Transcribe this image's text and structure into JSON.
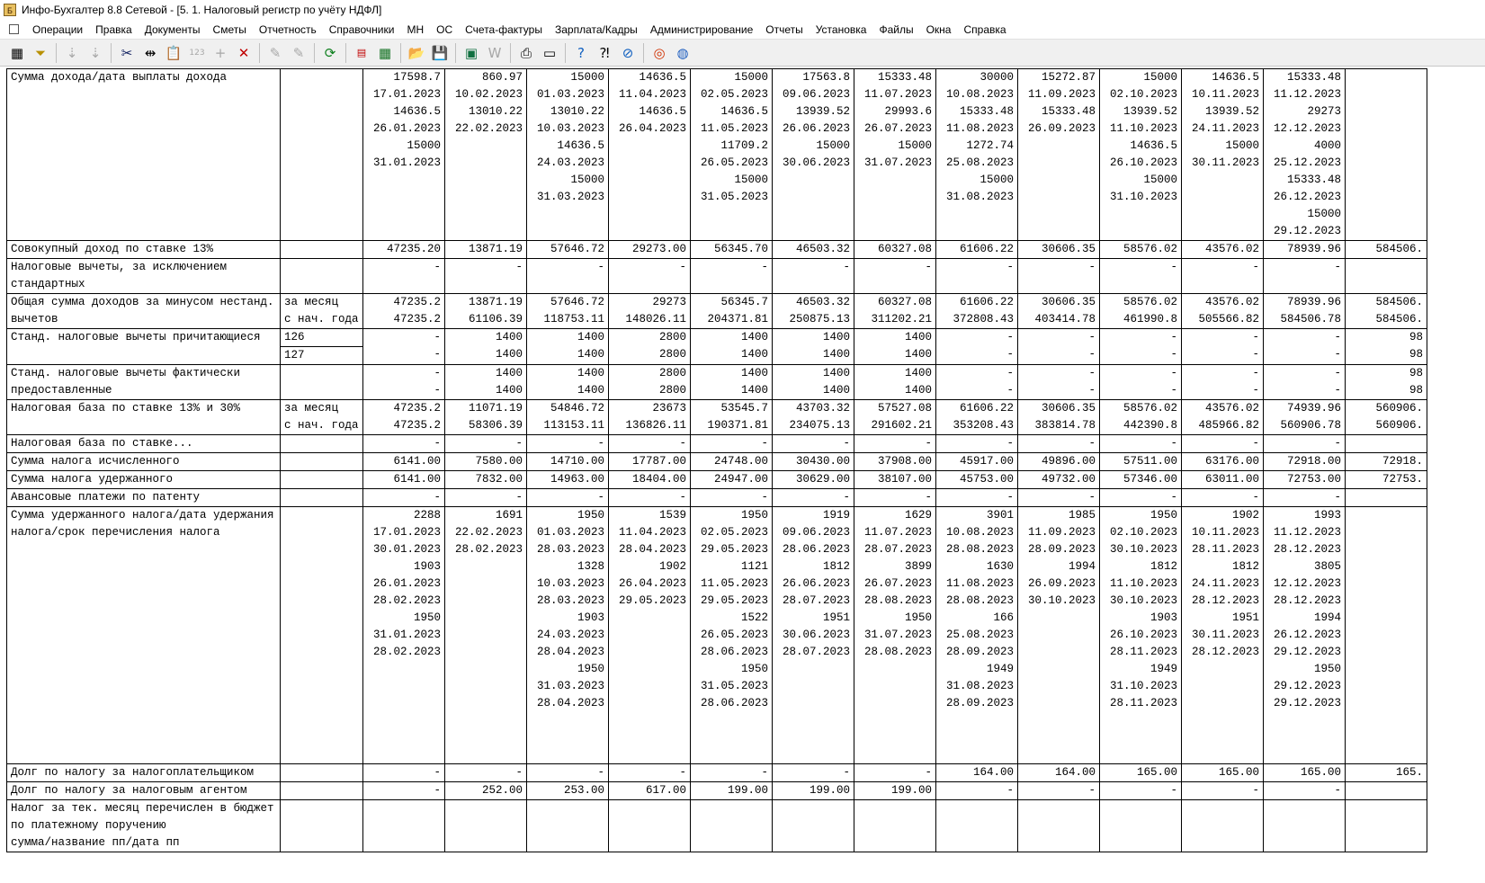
{
  "window": {
    "title": "Инфо-Бухгалтер 8.8 Сетевой - [5. 1. Налоговый регистр по учёту НДФЛ]"
  },
  "menu": [
    "Операции",
    "Правка",
    "Документы",
    "Сметы",
    "Отчетность",
    "Справочники",
    "МН",
    "ОС",
    "Счета-фактуры",
    "Зарплата/Кадры",
    "Администрирование",
    "Отчеты",
    "Установка",
    "Файлы",
    "Окна",
    "Справка"
  ],
  "toolbar_icons": [
    "table-icon",
    "filter-icon",
    "sort-asc-icon",
    "sort-desc-icon",
    "cut-icon",
    "columns-icon",
    "paste-icon",
    "numbering-icon",
    "add-icon",
    "delete-icon",
    "brush-icon",
    "brush-clear-icon",
    "refresh-icon",
    "pdf-icon",
    "calculator-icon",
    "open-folder-icon",
    "save-icon",
    "excel-icon",
    "word-icon",
    "print-icon",
    "preview-icon",
    "help-icon",
    "context-help-icon",
    "navigator-icon",
    "support-icon",
    "web-icon"
  ],
  "register": {
    "rows": [
      {
        "label": [
          "Сумма дохода/дата выплаты дохода"
        ],
        "sub": [
          ""
        ],
        "lines": 10,
        "cells": [
          [
            "17598.7",
            "17.01.2023",
            "14636.5",
            "26.01.2023",
            "15000",
            "31.01.2023"
          ],
          [
            "860.97",
            "10.02.2023",
            "13010.22",
            "22.02.2023"
          ],
          [
            "15000",
            "01.03.2023",
            "13010.22",
            "10.03.2023",
            "14636.5",
            "24.03.2023",
            "15000",
            "31.03.2023"
          ],
          [
            "14636.5",
            "11.04.2023",
            "14636.5",
            "26.04.2023"
          ],
          [
            "15000",
            "02.05.2023",
            "14636.5",
            "11.05.2023",
            "11709.2",
            "26.05.2023",
            "15000",
            "31.05.2023"
          ],
          [
            "17563.8",
            "09.06.2023",
            "13939.52",
            "26.06.2023",
            "15000",
            "30.06.2023"
          ],
          [
            "15333.48",
            "11.07.2023",
            "29993.6",
            "26.07.2023",
            "15000",
            "31.07.2023"
          ],
          [
            "30000",
            "10.08.2023",
            "15333.48",
            "11.08.2023",
            "1272.74",
            "25.08.2023",
            "15000",
            "31.08.2023"
          ],
          [
            "15272.87",
            "11.09.2023",
            "15333.48",
            "26.09.2023"
          ],
          [
            "15000",
            "02.10.2023",
            "13939.52",
            "11.10.2023",
            "14636.5",
            "26.10.2023",
            "15000",
            "31.10.2023"
          ],
          [
            "14636.5",
            "10.11.2023",
            "13939.52",
            "24.11.2023",
            "15000",
            "30.11.2023"
          ],
          [
            "15333.48",
            "11.12.2023",
            "29273",
            "12.12.2023",
            "4000",
            "25.12.2023",
            "15333.48",
            "26.12.2023",
            "15000",
            "29.12.2023"
          ],
          [
            ""
          ]
        ]
      },
      {
        "label": [
          "Совокупный доход по ставке 13%"
        ],
        "sub": [
          ""
        ],
        "lines": 1,
        "cells": [
          [
            "47235.20"
          ],
          [
            "13871.19"
          ],
          [
            "57646.72"
          ],
          [
            "29273.00"
          ],
          [
            "56345.70"
          ],
          [
            "46503.32"
          ],
          [
            "60327.08"
          ],
          [
            "61606.22"
          ],
          [
            "30606.35"
          ],
          [
            "58576.02"
          ],
          [
            "43576.02"
          ],
          [
            "78939.96"
          ],
          [
            "584506."
          ]
        ]
      },
      {
        "label": [
          "Налоговые вычеты, за исключением",
          "стандартных"
        ],
        "sub": [
          ""
        ],
        "lines": 2,
        "cells": [
          [
            "-"
          ],
          [
            "-"
          ],
          [
            "-"
          ],
          [
            "-"
          ],
          [
            "-"
          ],
          [
            "-"
          ],
          [
            "-"
          ],
          [
            "-"
          ],
          [
            "-"
          ],
          [
            "-"
          ],
          [
            "-"
          ],
          [
            "-"
          ],
          [
            ""
          ]
        ]
      },
      {
        "label": [
          "Общая сумма доходов за минусом нестанд.",
          "вычетов"
        ],
        "sub": [
          "за месяц",
          "с нач. года"
        ],
        "lines": 2,
        "cells": [
          [
            "47235.2",
            "47235.2"
          ],
          [
            "13871.19",
            "61106.39"
          ],
          [
            "57646.72",
            "118753.11"
          ],
          [
            "29273",
            "148026.11"
          ],
          [
            "56345.7",
            "204371.81"
          ],
          [
            "46503.32",
            "250875.13"
          ],
          [
            "60327.08",
            "311202.21"
          ],
          [
            "61606.22",
            "372808.43"
          ],
          [
            "30606.35",
            "403414.78"
          ],
          [
            "58576.02",
            "461990.8"
          ],
          [
            "43576.02",
            "505566.82"
          ],
          [
            "78939.96",
            "584506.78"
          ],
          [
            "584506.",
            "584506."
          ]
        ]
      },
      {
        "label": [
          "Станд. налоговые вычеты причитающиеся"
        ],
        "sub": [
          "126",
          "127"
        ],
        "lines": 2,
        "split_sub": true,
        "cells": [
          [
            "-",
            "-"
          ],
          [
            "1400",
            "1400"
          ],
          [
            "1400",
            "1400"
          ],
          [
            "2800",
            "2800"
          ],
          [
            "1400",
            "1400"
          ],
          [
            "1400",
            "1400"
          ],
          [
            "1400",
            "1400"
          ],
          [
            "-",
            "-"
          ],
          [
            "-",
            "-"
          ],
          [
            "-",
            "-"
          ],
          [
            "-",
            "-"
          ],
          [
            "-",
            "-"
          ],
          [
            "98",
            "98"
          ]
        ]
      },
      {
        "label": [
          "Станд. налоговые вычеты фактически",
          "предоставленные"
        ],
        "sub": [
          ""
        ],
        "lines": 2,
        "cells": [
          [
            "-",
            "-"
          ],
          [
            "1400",
            "1400"
          ],
          [
            "1400",
            "1400"
          ],
          [
            "2800",
            "2800"
          ],
          [
            "1400",
            "1400"
          ],
          [
            "1400",
            "1400"
          ],
          [
            "1400",
            "1400"
          ],
          [
            "-",
            "-"
          ],
          [
            "-",
            "-"
          ],
          [
            "-",
            "-"
          ],
          [
            "-",
            "-"
          ],
          [
            "-",
            "-"
          ],
          [
            "98",
            "98"
          ]
        ]
      },
      {
        "label": [
          "Налоговая база по ставке 13% и 30%"
        ],
        "sub": [
          "за месяц",
          "с нач. года"
        ],
        "lines": 2,
        "cells": [
          [
            "47235.2",
            "47235.2"
          ],
          [
            "11071.19",
            "58306.39"
          ],
          [
            "54846.72",
            "113153.11"
          ],
          [
            "23673",
            "136826.11"
          ],
          [
            "53545.7",
            "190371.81"
          ],
          [
            "43703.32",
            "234075.13"
          ],
          [
            "57527.08",
            "291602.21"
          ],
          [
            "61606.22",
            "353208.43"
          ],
          [
            "30606.35",
            "383814.78"
          ],
          [
            "58576.02",
            "442390.8"
          ],
          [
            "43576.02",
            "485966.82"
          ],
          [
            "74939.96",
            "560906.78"
          ],
          [
            "560906.",
            "560906."
          ]
        ]
      },
      {
        "label": [
          "Налоговая база по ставке..."
        ],
        "sub": [
          ""
        ],
        "lines": 1,
        "cells": [
          [
            "-"
          ],
          [
            "-"
          ],
          [
            "-"
          ],
          [
            "-"
          ],
          [
            "-"
          ],
          [
            "-"
          ],
          [
            "-"
          ],
          [
            "-"
          ],
          [
            "-"
          ],
          [
            "-"
          ],
          [
            "-"
          ],
          [
            "-"
          ],
          [
            ""
          ]
        ]
      },
      {
        "label": [
          "Сумма налога исчисленного"
        ],
        "sub": [
          ""
        ],
        "lines": 1,
        "cells": [
          [
            "6141.00"
          ],
          [
            "7580.00"
          ],
          [
            "14710.00"
          ],
          [
            "17787.00"
          ],
          [
            "24748.00"
          ],
          [
            "30430.00"
          ],
          [
            "37908.00"
          ],
          [
            "45917.00"
          ],
          [
            "49896.00"
          ],
          [
            "57511.00"
          ],
          [
            "63176.00"
          ],
          [
            "72918.00"
          ],
          [
            "72918."
          ]
        ]
      },
      {
        "label": [
          "Сумма налога удержанного"
        ],
        "sub": [
          ""
        ],
        "lines": 1,
        "cells": [
          [
            "6141.00"
          ],
          [
            "7832.00"
          ],
          [
            "14963.00"
          ],
          [
            "18404.00"
          ],
          [
            "24947.00"
          ],
          [
            "30629.00"
          ],
          [
            "38107.00"
          ],
          [
            "45753.00"
          ],
          [
            "49732.00"
          ],
          [
            "57346.00"
          ],
          [
            "63011.00"
          ],
          [
            "72753.00"
          ],
          [
            "72753."
          ]
        ]
      },
      {
        "label": [
          "Авансовые платежи по патенту"
        ],
        "sub": [
          ""
        ],
        "lines": 1,
        "cells": [
          [
            "-"
          ],
          [
            "-"
          ],
          [
            "-"
          ],
          [
            "-"
          ],
          [
            "-"
          ],
          [
            "-"
          ],
          [
            "-"
          ],
          [
            "-"
          ],
          [
            "-"
          ],
          [
            "-"
          ],
          [
            "-"
          ],
          [
            "-"
          ],
          [
            ""
          ]
        ]
      },
      {
        "label": [
          "Сумма удержанного налога/дата удержания",
          "налога/срок перечисления налога"
        ],
        "sub": [
          ""
        ],
        "lines": 15,
        "cells": [
          [
            "2288",
            "17.01.2023",
            "30.01.2023",
            "1903",
            "26.01.2023",
            "28.02.2023",
            "1950",
            "31.01.2023",
            "28.02.2023"
          ],
          [
            "1691",
            "22.02.2023",
            "28.02.2023"
          ],
          [
            "1950",
            "01.03.2023",
            "28.03.2023",
            "1328",
            "10.03.2023",
            "28.03.2023",
            "1903",
            "24.03.2023",
            "28.04.2023",
            "1950",
            "31.03.2023",
            "28.04.2023"
          ],
          [
            "1539",
            "11.04.2023",
            "28.04.2023",
            "1902",
            "26.04.2023",
            "29.05.2023"
          ],
          [
            "1950",
            "02.05.2023",
            "29.05.2023",
            "1121",
            "11.05.2023",
            "29.05.2023",
            "1522",
            "26.05.2023",
            "28.06.2023",
            "1950",
            "31.05.2023",
            "28.06.2023"
          ],
          [
            "1919",
            "09.06.2023",
            "28.06.2023",
            "1812",
            "26.06.2023",
            "28.07.2023",
            "1951",
            "30.06.2023",
            "28.07.2023"
          ],
          [
            "1629",
            "11.07.2023",
            "28.07.2023",
            "3899",
            "26.07.2023",
            "28.08.2023",
            "1950",
            "31.07.2023",
            "28.08.2023"
          ],
          [
            "3901",
            "10.08.2023",
            "28.08.2023",
            "1630",
            "11.08.2023",
            "28.08.2023",
            "166",
            "25.08.2023",
            "28.09.2023",
            "1949",
            "31.08.2023",
            "28.09.2023"
          ],
          [
            "1985",
            "11.09.2023",
            "28.09.2023",
            "1994",
            "26.09.2023",
            "30.10.2023"
          ],
          [
            "1950",
            "02.10.2023",
            "30.10.2023",
            "1812",
            "11.10.2023",
            "30.10.2023",
            "1903",
            "26.10.2023",
            "28.11.2023",
            "1949",
            "31.10.2023",
            "28.11.2023"
          ],
          [
            "1902",
            "10.11.2023",
            "28.11.2023",
            "1812",
            "24.11.2023",
            "28.12.2023",
            "1951",
            "30.11.2023",
            "28.12.2023"
          ],
          [
            "1993",
            "11.12.2023",
            "28.12.2023",
            "3805",
            "12.12.2023",
            "28.12.2023",
            "1994",
            "26.12.2023",
            "29.12.2023",
            "1950",
            "29.12.2023",
            "29.12.2023"
          ],
          [
            ""
          ]
        ]
      },
      {
        "label": [
          "Долг по налогу за налогоплательщиком"
        ],
        "sub": [
          ""
        ],
        "lines": 1,
        "cells": [
          [
            "-"
          ],
          [
            "-"
          ],
          [
            "-"
          ],
          [
            "-"
          ],
          [
            "-"
          ],
          [
            "-"
          ],
          [
            "-"
          ],
          [
            "164.00"
          ],
          [
            "164.00"
          ],
          [
            "165.00"
          ],
          [
            "165.00"
          ],
          [
            "165.00"
          ],
          [
            "165."
          ]
        ]
      },
      {
        "label": [
          "Долг по налогу за налоговым агентом"
        ],
        "sub": [
          ""
        ],
        "lines": 1,
        "cells": [
          [
            "-"
          ],
          [
            "252.00"
          ],
          [
            "253.00"
          ],
          [
            "617.00"
          ],
          [
            "199.00"
          ],
          [
            "199.00"
          ],
          [
            "199.00"
          ],
          [
            "-"
          ],
          [
            "-"
          ],
          [
            "-"
          ],
          [
            "-"
          ],
          [
            "-"
          ],
          [
            ""
          ]
        ]
      },
      {
        "label": [
          "Налог за тек. месяц перечислен в бюджет",
          "по платежному поручению",
          "сумма/название пп/дата пп"
        ],
        "sub": [
          ""
        ],
        "lines": 3,
        "cells": [
          [
            ""
          ],
          [
            ""
          ],
          [
            ""
          ],
          [
            ""
          ],
          [
            ""
          ],
          [
            ""
          ],
          [
            ""
          ],
          [
            ""
          ],
          [
            ""
          ],
          [
            ""
          ],
          [
            ""
          ],
          [
            ""
          ],
          [
            ""
          ]
        ]
      }
    ]
  }
}
